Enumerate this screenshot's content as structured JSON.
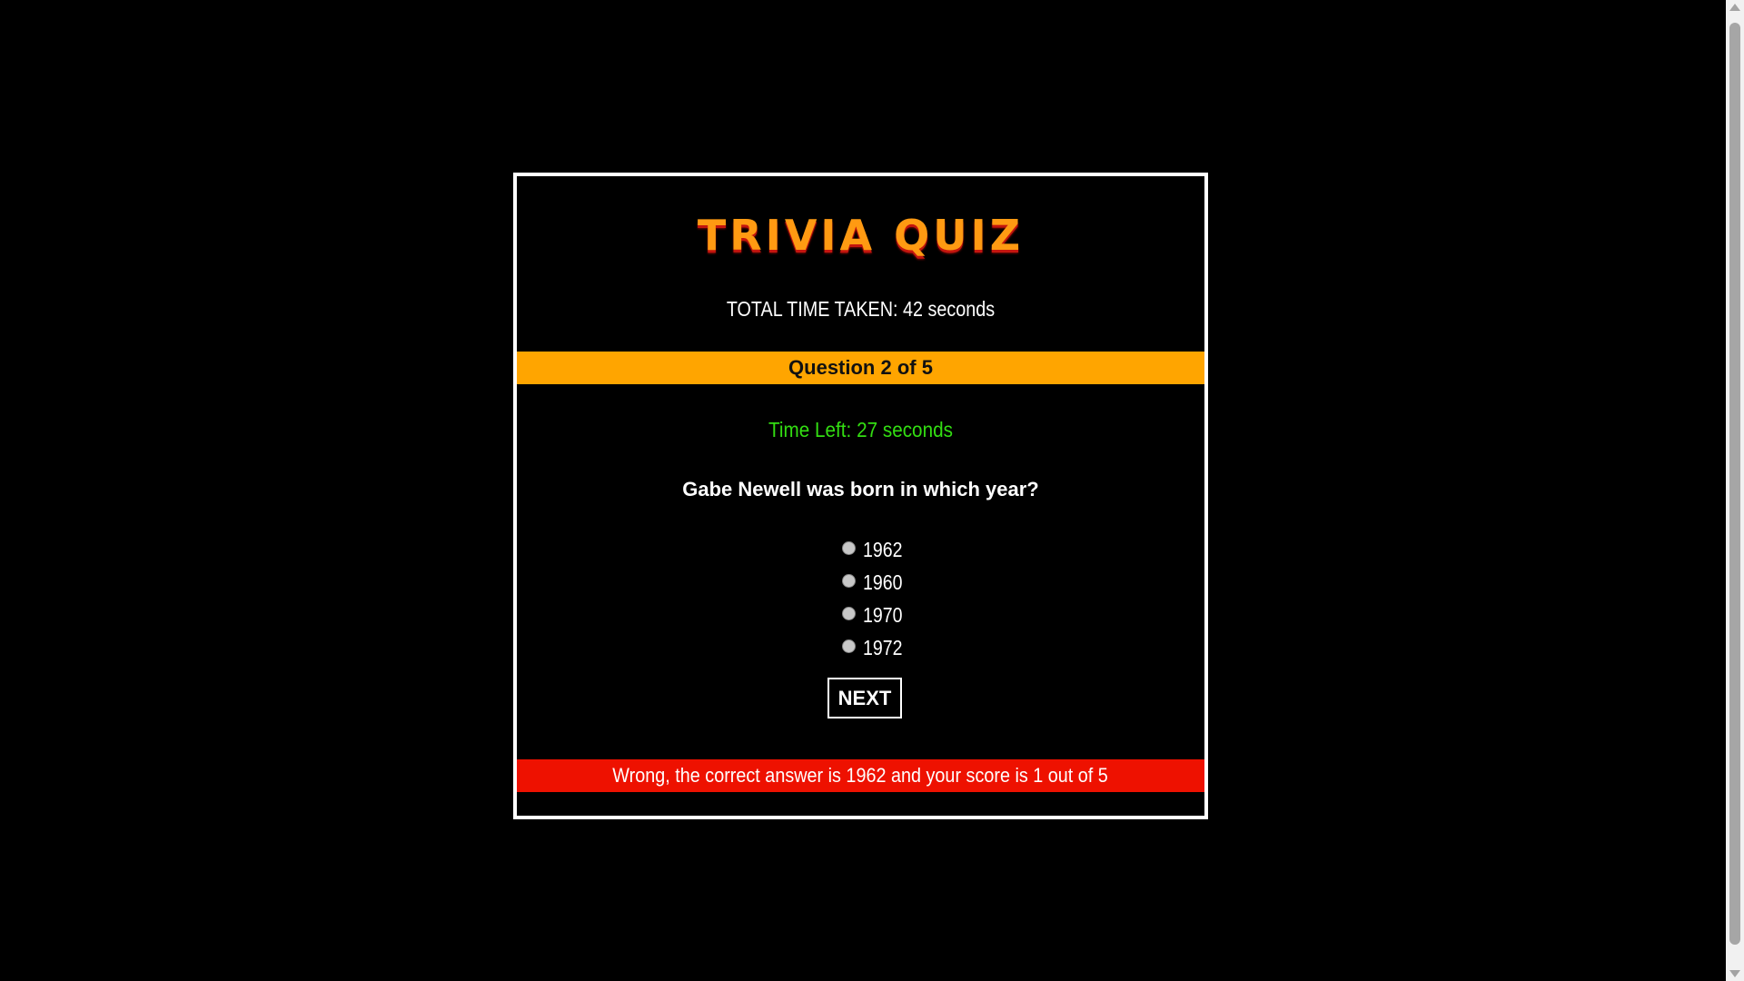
{
  "quiz": {
    "title": "TRIVIA QUIZ",
    "total_time": "TOTAL TIME TAKEN: 42 seconds",
    "question_counter": "Question 2 of 5",
    "time_left": "Time Left: 27 seconds",
    "question": "Gabe Newell was born in which year?",
    "options": [
      {
        "label": "1962",
        "selected": false
      },
      {
        "label": "1960",
        "selected": false
      },
      {
        "label": "1970",
        "selected": false
      },
      {
        "label": "1972",
        "selected": false
      }
    ],
    "next_label": "NEXT",
    "feedback": "Wrong, the correct answer is 1962 and your score is 1 out of 5"
  },
  "colors": {
    "background": "#000000",
    "title": "#ff9a12",
    "question_bar": "#ffa500",
    "time_left": "#33dd12",
    "feedback_bar": "#ee1100"
  }
}
